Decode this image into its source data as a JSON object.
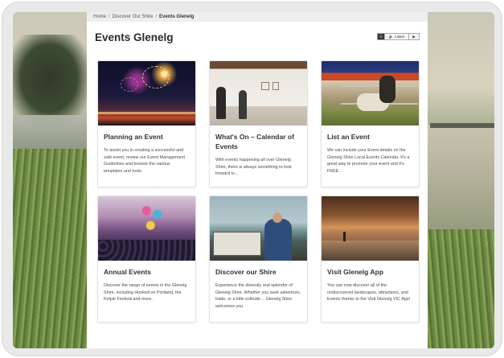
{
  "breadcrumb": {
    "items": [
      "Home",
      "Discover Our Shire",
      "Events Glenelg"
    ],
    "separator": "/"
  },
  "page": {
    "title": "Events Glenelg"
  },
  "listen_widget": {
    "listen_label": "Listen"
  },
  "cards": [
    {
      "title": "Planning an Event",
      "text": "To assist you in creating a successful and safe event, review our Event Management Guidelines and browse the various templates and tools.",
      "image": "fireworks-photo"
    },
    {
      "title": "What's On – Calendar of Events",
      "text": "With events happening all over Glenelg Shire, there is always something to look forward to…",
      "image": "gallery-photo"
    },
    {
      "title": "List an Event",
      "text": "We can include your Event details on the Glenelg Shire Local Events Calendar. It's a great way to promote your event and it's FREE.",
      "image": "sheep-photo"
    },
    {
      "title": "Annual Events",
      "text": "Discover the range of events in the Glenelg Shire, including Hooked on Portland, the Kelpie Festival and more.",
      "image": "festival-photo"
    },
    {
      "title": "Discover our Shire",
      "text": "Experience the diversity and splendor of Glenelg Shire. Whether you seek adventure, trade, or a little solitude… Glenelg Shire welcomes you.",
      "image": "boat-photo"
    },
    {
      "title": "Visit Glenelg App",
      "text": "You can now discover all of the undiscovered landscapes, attractions, and Events thanks to the Visit Glenelg VIC App!",
      "image": "beach-sunset-photo"
    }
  ]
}
